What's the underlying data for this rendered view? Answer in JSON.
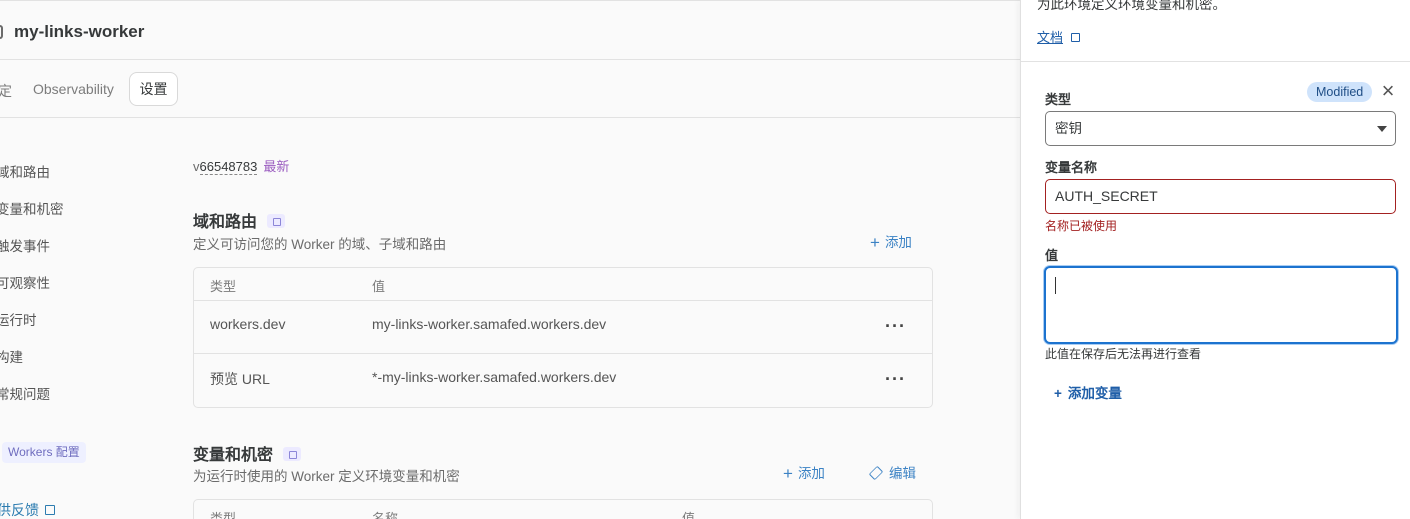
{
  "worker": {
    "title": "my-links-worker"
  },
  "tabs": {
    "cut_label": "定",
    "observability": "Observability",
    "settings": "设置"
  },
  "sidebar": {
    "items": [
      "域和路由",
      "变量和机密",
      "触发事件",
      "可观察性",
      "运行时",
      "构建",
      "常规问题"
    ],
    "workers_badge": "Workers 配置",
    "feedback": "供反馈"
  },
  "version": {
    "prefix": "v",
    "number": "66548783",
    "latest": "最新"
  },
  "domains": {
    "title": "域和路由",
    "subtitle": "定义可访问您的 Worker 的域、子域和路由",
    "add_label": "添加",
    "columns": [
      "类型",
      "值"
    ],
    "rows": [
      {
        "type": "workers.dev",
        "value": "my-links-worker.samafed.workers.dev"
      },
      {
        "type": "预览 URL",
        "value": "*-my-links-worker.samafed.workers.dev"
      }
    ]
  },
  "variables": {
    "title": "变量和机密",
    "subtitle": "为运行时使用的 Worker 定义环境变量和机密",
    "add_label": "添加",
    "edit_label": "编辑",
    "columns": [
      "类型",
      "名称",
      "值"
    ]
  },
  "drawer": {
    "description": "为此环境定义环境变量和机密。",
    "doc_link": "文档",
    "type_label": "类型",
    "modified_badge": "Modified",
    "type_value": "密钥",
    "name_label": "变量名称",
    "name_value": "AUTH_SECRET",
    "name_error": "名称已被使用",
    "value_label": "值",
    "value_value": "",
    "value_hint": "此值在保存后无法再进行查看",
    "add_variable": "添加变量"
  },
  "colors": {
    "accent_link": "#1f5ea8",
    "error": "#a32121",
    "focus_ring": "#1c73cf",
    "modified_bg": "#cfe3fb"
  }
}
